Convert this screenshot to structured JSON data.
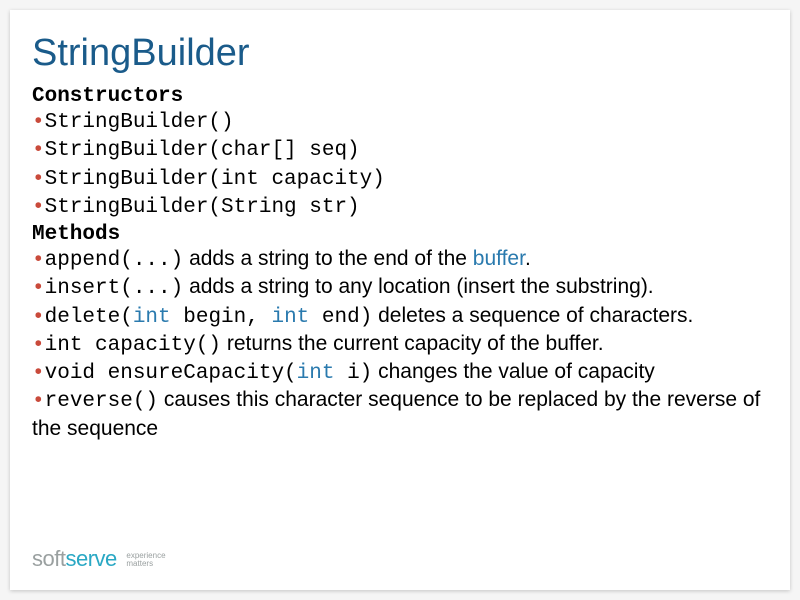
{
  "title": "StringBuilder",
  "sections": {
    "constructors_label": "Constructors",
    "methods_label": "Methods"
  },
  "constructors": [
    "StringBuilder()",
    "StringBuilder(char[] seq)",
    "StringBuilder(int capacity)",
    "StringBuilder(String str)"
  ],
  "methods": {
    "append": {
      "code": "append(...)",
      "desc_pre": " adds a string to the end of the ",
      "link": "buffer",
      "desc_post": "."
    },
    "insert": {
      "code": "insert(...)",
      "desc": " adds a string to any location (insert the substring)."
    },
    "delete": {
      "pre": "delete(",
      "kw1": "int",
      "mid1": " begin, ",
      "kw2": "int",
      "mid2": " end)",
      "desc": " deletes a sequence of characters."
    },
    "capacity": {
      "code": "int capacity()",
      "desc": " returns the current capacity of the buffer."
    },
    "ensure": {
      "pre": "void ensureCapacity(",
      "kw": "int",
      "post": " i)",
      "desc": " changes the value of capacity"
    },
    "reverse": {
      "code": "reverse()",
      "desc": " causes this character sequence to be replaced by the reverse of the sequence"
    }
  },
  "bullet": "•",
  "logo": {
    "soft": "soft",
    "serve": "serve",
    "tag1": "experience",
    "tag2": "matters"
  }
}
